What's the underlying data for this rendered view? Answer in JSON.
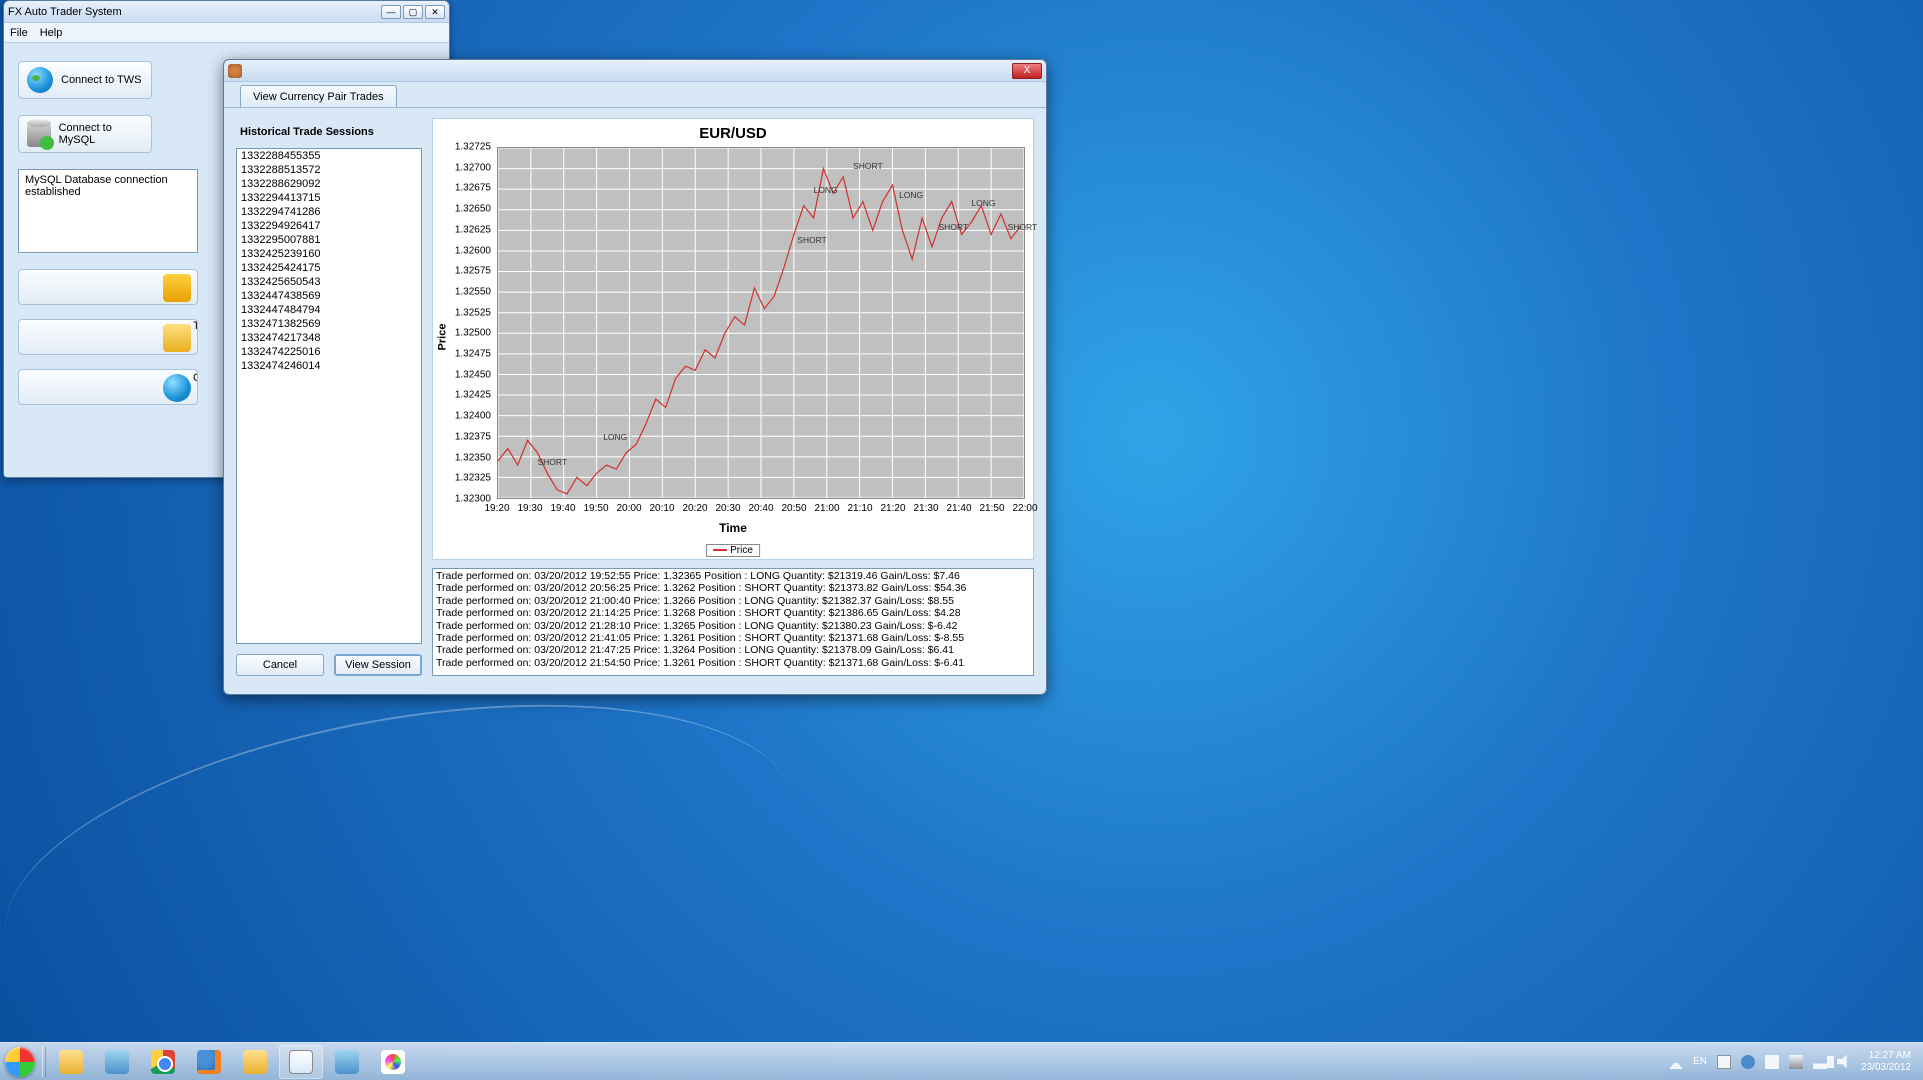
{
  "main_window": {
    "title": "FX Auto Trader System",
    "menu": {
      "file": "File",
      "help": "Help"
    },
    "connect_tws": "Connect to TWS",
    "connect_mysql": "Connect to MySQL",
    "log_message": "MySQL Database connection established",
    "extra_c_label": "C",
    "extra_t_label": "T"
  },
  "dialog": {
    "tab_label": "View Currency Pair Trades",
    "historical_title": "Historical Trade Sessions",
    "sessions": [
      "1332288455355",
      "1332288513572",
      "1332288629092",
      "1332294413715",
      "1332294741286",
      "1332294926417",
      "1332295007881",
      "1332425239160",
      "1332425424175",
      "1332425650543",
      "1332447438569",
      "1332447484794",
      "1332471382569",
      "1332474217348",
      "1332474225016",
      "1332474246014"
    ],
    "cancel_label": "Cancel",
    "view_session_label": "View Session",
    "close_label": "X",
    "trade_log": [
      "Trade performed on: 03/20/2012 19:52:55 Price: 1.32365 Position : LONG Quantity: $21319.46 Gain/Loss: $7.46",
      "Trade performed on: 03/20/2012 20:56:25 Price: 1.3262 Position : SHORT Quantity: $21373.82 Gain/Loss: $54.36",
      "Trade performed on: 03/20/2012 21:00:40 Price: 1.3266 Position : LONG Quantity: $21382.37 Gain/Loss: $8.55",
      "Trade performed on: 03/20/2012 21:14:25 Price: 1.3268 Position : SHORT Quantity: $21386.65 Gain/Loss: $4.28",
      "Trade performed on: 03/20/2012 21:28:10 Price: 1.3265 Position : LONG Quantity: $21380.23 Gain/Loss: $-6.42",
      "Trade performed on: 03/20/2012 21:41:05 Price: 1.3261 Position : SHORT Quantity: $21371.68 Gain/Loss: $-8.55",
      "Trade performed on: 03/20/2012 21:47:25 Price: 1.3264 Position : LONG Quantity: $21378.09 Gain/Loss: $6.41",
      "Trade performed on: 03/20/2012 21:54:50 Price: 1.3261 Position : SHORT Quantity: $21371.68 Gain/Loss: $-6.41"
    ]
  },
  "chart_data": {
    "type": "line",
    "title": "EUR/USD",
    "xlabel": "Time",
    "ylabel": "Price",
    "legend_label": "Price",
    "ylim": [
      1.323,
      1.32725
    ],
    "y_ticks": [
      1.32725,
      1.327,
      1.32675,
      1.3265,
      1.32625,
      1.326,
      1.32575,
      1.3255,
      1.32525,
      1.325,
      1.32475,
      1.3245,
      1.32425,
      1.324,
      1.32375,
      1.3235,
      1.32325,
      1.323
    ],
    "x_ticks": [
      "19:20",
      "19:30",
      "19:40",
      "19:50",
      "20:00",
      "20:10",
      "20:20",
      "20:30",
      "20:40",
      "20:50",
      "21:00",
      "21:10",
      "21:20",
      "21:30",
      "21:40",
      "21:50",
      "22:00"
    ],
    "xmin_minutes": 1160,
    "xmax_minutes": 1320,
    "series": [
      {
        "name": "Price",
        "x_minutes": [
          1160,
          1163,
          1166,
          1169,
          1172,
          1175,
          1178,
          1181,
          1184,
          1187,
          1190,
          1193,
          1196,
          1199,
          1202,
          1205,
          1208,
          1211,
          1214,
          1217,
          1220,
          1223,
          1226,
          1229,
          1232,
          1235,
          1238,
          1241,
          1244,
          1247,
          1250,
          1253,
          1256,
          1259,
          1262,
          1265,
          1268,
          1271,
          1274,
          1277,
          1280,
          1283,
          1286,
          1289,
          1292,
          1295,
          1298,
          1301,
          1304,
          1307,
          1310,
          1313,
          1316,
          1319
        ],
        "y": [
          1.32345,
          1.3236,
          1.3234,
          1.3237,
          1.32355,
          1.3233,
          1.3231,
          1.32305,
          1.32325,
          1.32315,
          1.3233,
          1.3234,
          1.32335,
          1.32355,
          1.32365,
          1.3239,
          1.3242,
          1.3241,
          1.32445,
          1.3246,
          1.32455,
          1.3248,
          1.3247,
          1.325,
          1.3252,
          1.3251,
          1.32555,
          1.3253,
          1.32545,
          1.3258,
          1.3262,
          1.32655,
          1.3264,
          1.327,
          1.3267,
          1.3269,
          1.3264,
          1.3266,
          1.32625,
          1.3266,
          1.3268,
          1.32625,
          1.3259,
          1.3264,
          1.32605,
          1.3264,
          1.3266,
          1.3262,
          1.32635,
          1.32655,
          1.3262,
          1.32645,
          1.32615,
          1.3263
        ]
      }
    ],
    "annotations": [
      {
        "label": "SHORT",
        "x_minutes": 1172,
        "y": 1.32335
      },
      {
        "label": "LONG",
        "x_minutes": 1192,
        "y": 1.32365
      },
      {
        "label": "SHORT",
        "x_minutes": 1251,
        "y": 1.32605
      },
      {
        "label": "LONG",
        "x_minutes": 1256,
        "y": 1.32665
      },
      {
        "label": "SHORT",
        "x_minutes": 1268,
        "y": 1.32695
      },
      {
        "label": "LONG",
        "x_minutes": 1282,
        "y": 1.3266
      },
      {
        "label": "SHORT",
        "x_minutes": 1294,
        "y": 1.3262
      },
      {
        "label": "LONG",
        "x_minutes": 1304,
        "y": 1.3265
      },
      {
        "label": "SHORT",
        "x_minutes": 1315,
        "y": 1.3262
      }
    ]
  },
  "taskbar": {
    "lang": "EN",
    "time": "12:27 AM",
    "date": "23/03/2012"
  }
}
